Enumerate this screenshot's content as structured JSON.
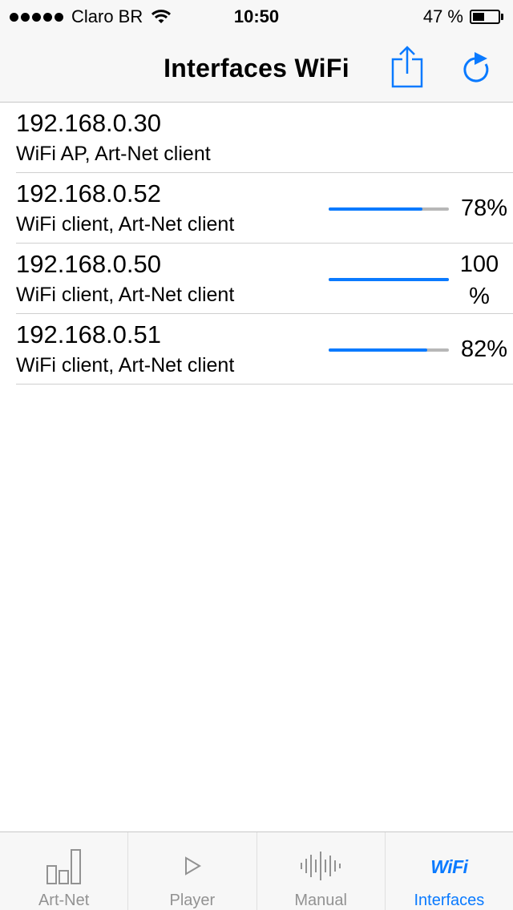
{
  "status_bar": {
    "carrier": "Claro BR",
    "time": "10:50",
    "battery_percent": "47 %",
    "battery_level": 0.47,
    "signal_dots": 5
  },
  "nav": {
    "title": "Interfaces WiFi",
    "share_icon": "share-icon",
    "refresh_icon": "refresh-icon"
  },
  "interfaces": [
    {
      "ip": "192.168.0.30",
      "desc": "WiFi AP, Art-Net client",
      "pct_text": null,
      "level": null
    },
    {
      "ip": "192.168.0.52",
      "desc": "WiFi client, Art-Net client",
      "pct_text": "78%",
      "level": 0.78
    },
    {
      "ip": "192.168.0.50",
      "desc": "WiFi client, Art-Net client",
      "pct_text": "100 %",
      "level": 1.0
    },
    {
      "ip": "192.168.0.51",
      "desc": "WiFi client, Art-Net client",
      "pct_text": "82%",
      "level": 0.82
    }
  ],
  "tabs": [
    {
      "label": "Art-Net",
      "icon": "bar-chart-icon",
      "active": false
    },
    {
      "label": "Player",
      "icon": "play-icon",
      "active": false
    },
    {
      "label": "Manual",
      "icon": "waveform-icon",
      "active": false
    },
    {
      "label": "Interfaces",
      "icon": "wifi-icon",
      "icon_text": "WiFi",
      "active": true
    }
  ],
  "colors": {
    "accent": "#0a7aff",
    "bar_track": "#b7b7b7",
    "inactive_tab": "#929292"
  }
}
